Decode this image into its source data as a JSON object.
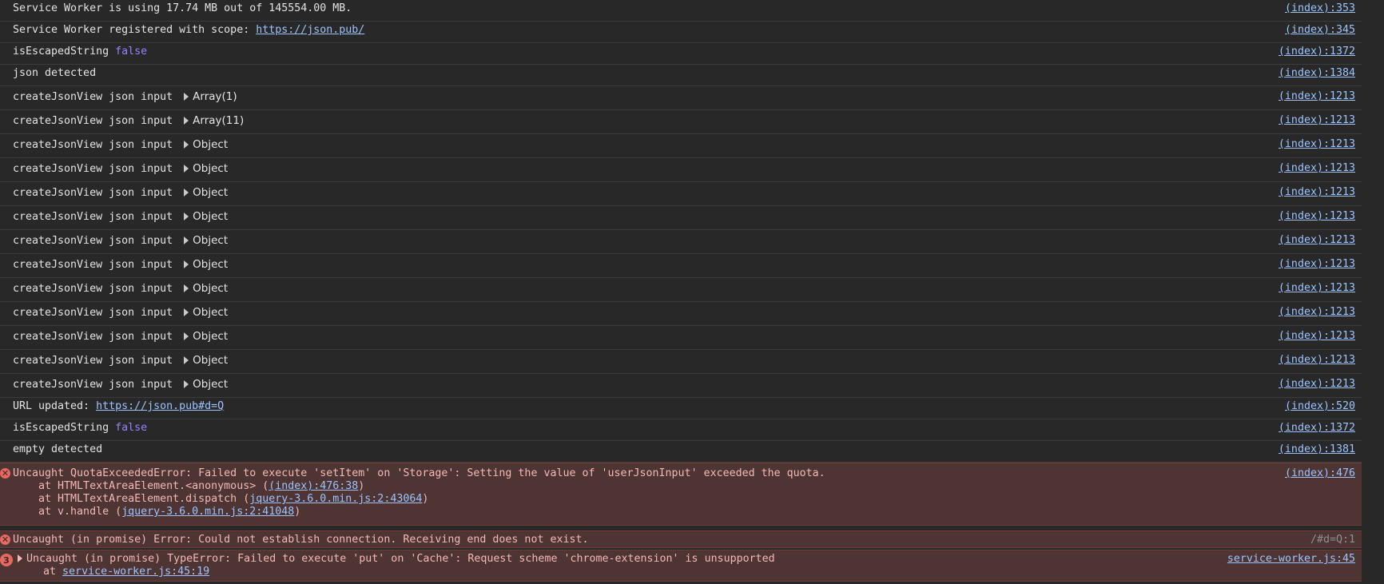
{
  "logs": [
    {
      "text": "Service Worker is using 17.74 MB out of 145554.00 MB.",
      "source": "(index):353"
    },
    {
      "text": "Service Worker registered with scope: ",
      "link": "https://json.pub/",
      "source": "(index):345"
    },
    {
      "text": "isEscapedString ",
      "keyword": "false",
      "source": "(index):1372"
    },
    {
      "text": "json detected",
      "source": "(index):1384"
    },
    {
      "text": "createJsonView json input",
      "obj": "Array(1)",
      "source": "(index):1213"
    },
    {
      "text": "createJsonView json input",
      "obj": "Array(11)",
      "source": "(index):1213"
    },
    {
      "text": "createJsonView json input",
      "obj": "Object",
      "source": "(index):1213"
    },
    {
      "text": "createJsonView json input",
      "obj": "Object",
      "source": "(index):1213"
    },
    {
      "text": "createJsonView json input",
      "obj": "Object",
      "source": "(index):1213"
    },
    {
      "text": "createJsonView json input",
      "obj": "Object",
      "source": "(index):1213"
    },
    {
      "text": "createJsonView json input",
      "obj": "Object",
      "source": "(index):1213"
    },
    {
      "text": "createJsonView json input",
      "obj": "Object",
      "source": "(index):1213"
    },
    {
      "text": "createJsonView json input",
      "obj": "Object",
      "source": "(index):1213"
    },
    {
      "text": "createJsonView json input",
      "obj": "Object",
      "source": "(index):1213"
    },
    {
      "text": "createJsonView json input",
      "obj": "Object",
      "source": "(index):1213"
    },
    {
      "text": "createJsonView json input",
      "obj": "Object",
      "source": "(index):1213"
    },
    {
      "text": "createJsonView json input",
      "obj": "Object",
      "source": "(index):1213"
    },
    {
      "text": "URL updated: ",
      "link": "https://json.pub#d=Q",
      "source": "(index):520"
    },
    {
      "text": "isEscapedString ",
      "keyword": "false",
      "source": "(index):1372"
    },
    {
      "text": "empty detected",
      "source": "(index):1381"
    }
  ],
  "errors": {
    "quota": {
      "icon": "✕",
      "text": "Uncaught QuotaExceededError: Failed to execute 'setItem' on 'Storage': Setting the value of 'userJsonInput' exceeded the quota.",
      "source": "(index):476",
      "stack1_pre": "    at HTMLTextAreaElement.<anonymous> (",
      "stack1_link": "(index):476:38",
      "stack1_post": ")",
      "stack2_pre": "    at HTMLTextAreaElement.dispatch (",
      "stack2_link": "jquery-3.6.0.min.js:2:43064",
      "stack2_post": ")",
      "stack3_pre": "    at v.handle (",
      "stack3_link": "jquery-3.6.0.min.js:2:41048",
      "stack3_post": ")"
    },
    "promise": {
      "icon": "✕",
      "text": "Uncaught (in promise) Error: Could not establish connection. Receiving end does not exist.",
      "source": "/#d=Q:1"
    },
    "typeerror": {
      "count": "3",
      "text": "Uncaught (in promise) TypeError: Failed to execute 'put' on 'Cache': Request scheme 'chrome-extension' is unsupported",
      "source": "service-worker.js:45",
      "stack_pre": "    at ",
      "stack_link": "service-worker.js:45:19"
    }
  },
  "colors": {
    "background": "#282828",
    "error_bg": "#4e3534",
    "link": "#9cc3ff",
    "keyword": "#9980ff",
    "error_text": "#f2b8b5"
  }
}
